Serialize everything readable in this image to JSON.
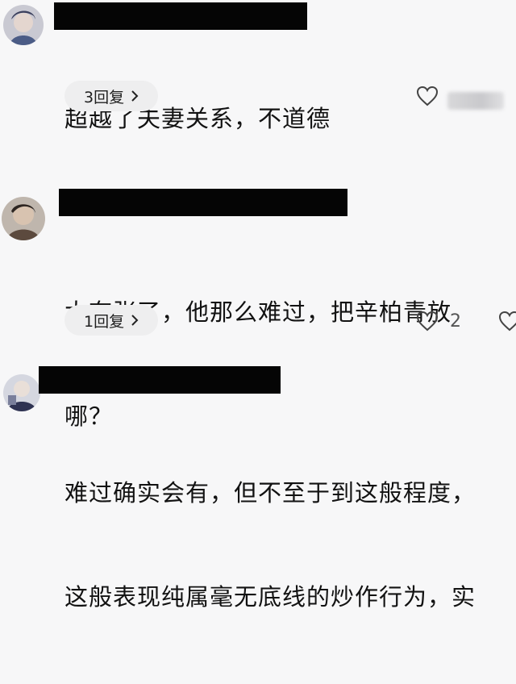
{
  "comments": [
    {
      "text_lines": [
        "超越了夫妻关系，不道德"
      ],
      "reply_label": "3回复",
      "like_count": ""
    },
    {
      "text_lines": [
        "太夸张了，他那么难过，把辛柏青放",
        "哪？"
      ],
      "reply_label": "1回复",
      "like_count": "2"
    },
    {
      "text_lines": [
        "难过确实会有，但不至于到这般程度，",
        "这般表现纯属毫无底线的炒作行为，实"
      ],
      "reply_label": "",
      "like_count": ""
    }
  ],
  "icons": {
    "reply_chevron": "chevron-right-icon",
    "like": "heart-outline-icon"
  },
  "colors": {
    "background": "#f7f7f8",
    "reply_pill": "#eeeeef",
    "redaction": "#050505"
  }
}
